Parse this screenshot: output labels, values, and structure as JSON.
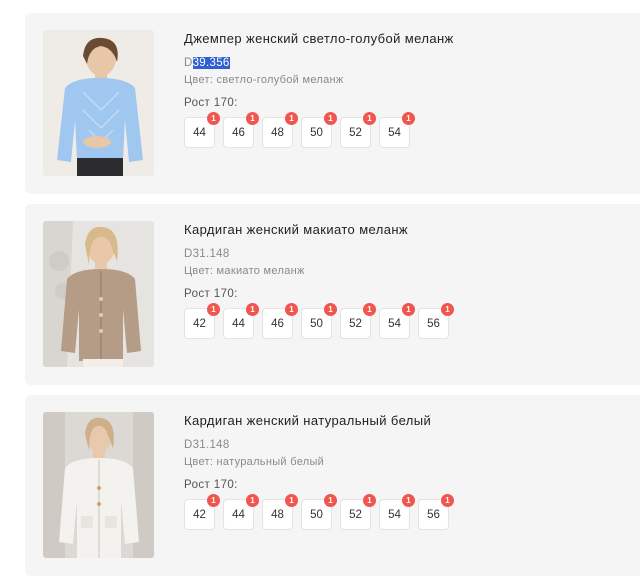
{
  "products": [
    {
      "title": "Джемпер женский светло-голубой меланж",
      "sku_prefix": "D",
      "sku_selected": "39.356",
      "color": "Цвет: светло-голубой меланж",
      "height": "Рост 170:",
      "image_icon": "model-photo-blue-jumper-icon",
      "sizes": [
        {
          "label": "44",
          "count": "1"
        },
        {
          "label": "46",
          "count": "1"
        },
        {
          "label": "48",
          "count": "1"
        },
        {
          "label": "50",
          "count": "1"
        },
        {
          "label": "52",
          "count": "1"
        },
        {
          "label": "54",
          "count": "1"
        }
      ]
    },
    {
      "title": "Кардиган женский макиато меланж",
      "sku_prefix": "D31.148",
      "sku_selected": "",
      "color": "Цвет: макиато меланж",
      "height": "Рост 170:",
      "image_icon": "model-photo-beige-cardigan-icon",
      "sizes": [
        {
          "label": "42",
          "count": "1"
        },
        {
          "label": "44",
          "count": "1"
        },
        {
          "label": "46",
          "count": "1"
        },
        {
          "label": "50",
          "count": "1"
        },
        {
          "label": "52",
          "count": "1"
        },
        {
          "label": "54",
          "count": "1"
        },
        {
          "label": "56",
          "count": "1"
        }
      ]
    },
    {
      "title": "Кардиган женский натуральный белый",
      "sku_prefix": "D31.148",
      "sku_selected": "",
      "color": "Цвет: натуральный белый",
      "height": "Рост 170:",
      "image_icon": "model-photo-white-cardigan-icon",
      "sizes": [
        {
          "label": "42",
          "count": "1"
        },
        {
          "label": "44",
          "count": "1"
        },
        {
          "label": "48",
          "count": "1"
        },
        {
          "label": "50",
          "count": "1"
        },
        {
          "label": "52",
          "count": "1"
        },
        {
          "label": "54",
          "count": "1"
        },
        {
          "label": "56",
          "count": "1"
        }
      ]
    }
  ],
  "colors": {
    "card_bg": "#f5f5f5",
    "badge": "#f0554e",
    "selection": "#2f5fd3"
  }
}
